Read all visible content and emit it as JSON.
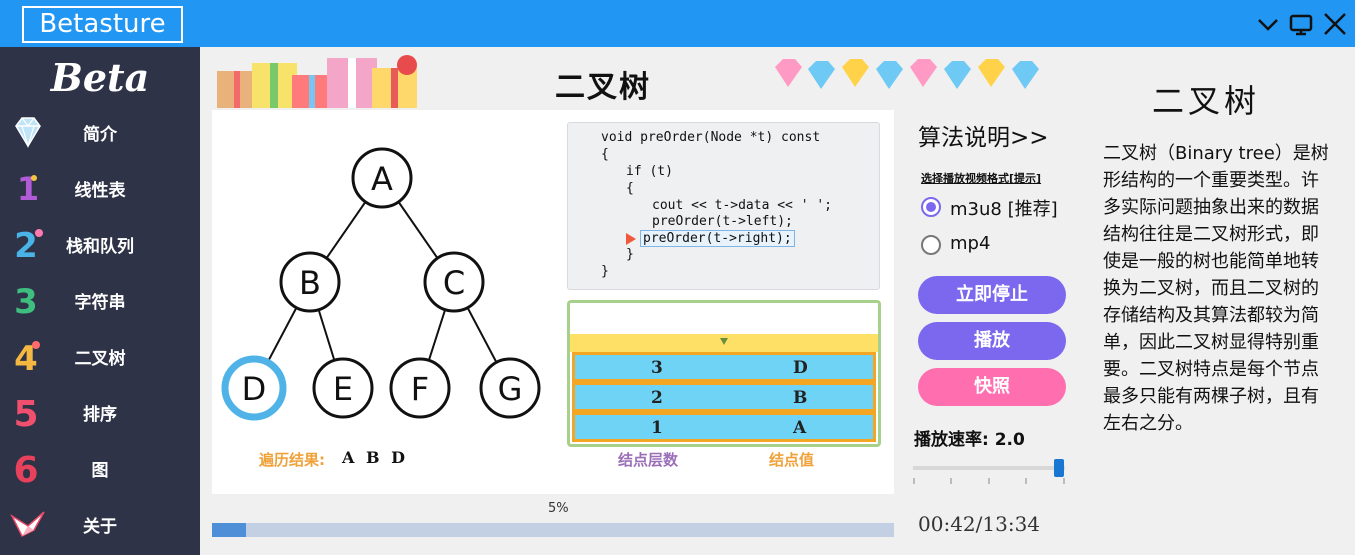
{
  "window": {
    "app_name": "Betasture",
    "controls": [
      "chevron-down-icon",
      "monitor-icon",
      "close-icon"
    ]
  },
  "sidebar": {
    "brand": "Beta",
    "items": [
      {
        "icon": "diamond-icon",
        "label": "简介"
      },
      {
        "icon": "number-1-icon",
        "label": "线性表"
      },
      {
        "icon": "number-2-icon",
        "label": "栈和队列"
      },
      {
        "icon": "number-3-icon",
        "label": "字符串"
      },
      {
        "icon": "number-4-icon",
        "label": "二叉树"
      },
      {
        "icon": "number-5-icon",
        "label": "排序"
      },
      {
        "icon": "number-6-icon",
        "label": "图"
      },
      {
        "icon": "origami-bird-icon",
        "label": "关于"
      }
    ]
  },
  "main": {
    "title": "二叉树",
    "tree": {
      "nodes": [
        "A",
        "B",
        "C",
        "D",
        "E",
        "F",
        "G"
      ],
      "highlighted": "D"
    },
    "traverse": {
      "label": "遍历结果:",
      "value": "A B D"
    },
    "code": [
      "void preOrder(Node *t) const",
      "{",
      "if (t)",
      "{",
      "cout << t->data << ' ';",
      "preOrder(t->left);",
      "preOrder(t->right);",
      "}",
      "}"
    ],
    "stack": {
      "rows": [
        {
          "level": "3",
          "value": "D"
        },
        {
          "level": "2",
          "value": "B"
        },
        {
          "level": "1",
          "value": "A"
        }
      ],
      "legend_level": "结点层数",
      "legend_value": "结点值"
    },
    "progress": {
      "percent_text": "5%",
      "fraction": 0.05
    },
    "time": "00:42/13:34"
  },
  "controls": {
    "algo_title": "算法说明>>",
    "format_label": "选择播放视频格式[提示]",
    "formats": [
      {
        "label": "m3u8 [推荐]",
        "selected": true
      },
      {
        "label": "mp4",
        "selected": false
      }
    ],
    "buttons": {
      "stop": "立即停止",
      "play": "播放",
      "snapshot": "快照"
    },
    "speed_label": "播放速率: 2.0",
    "speed_fraction": 1.0
  },
  "info": {
    "title": "二叉树",
    "text": "二叉树（Binary tree）是树形结构的一个重要类型。许多实际问题抽象出来的数据结构往往是二叉树形式，即使是一般的树也能简单地转换为二叉树，而且二叉树的存储结构及其算法都较为简单，因此二叉树显得特别重要。二叉树特点是每个节点最多只能有两棵子树，且有左右之分。"
  },
  "colors": {
    "titlebar": "#2196f3",
    "sidebar": "#2e3347",
    "stop_button": "#7b68ee",
    "play_button": "#7b68ee",
    "snapshot_button": "#ff6fb0",
    "highlight_node": "#4fb3e8"
  }
}
